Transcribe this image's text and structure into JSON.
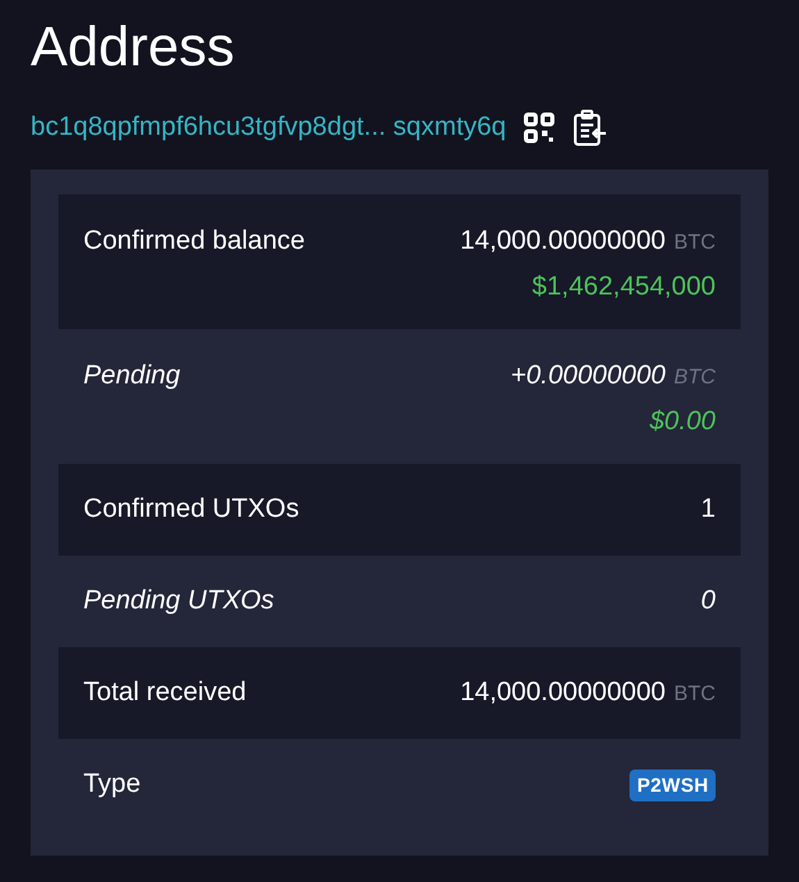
{
  "title": "Address",
  "address": {
    "start": "bc1q8qpfmpf6hcu3tgfvp8dgt...",
    "end": "sqxmty6q"
  },
  "rows": [
    {
      "kind": "amount",
      "label": "Confirmed balance",
      "pending": false,
      "value": "14,000.00000000",
      "unit": "BTC",
      "fiat": "$1,462,454,000"
    },
    {
      "kind": "amount",
      "label": "Pending",
      "pending": true,
      "value": "+0.00000000",
      "unit": "BTC",
      "fiat": "$0.00"
    },
    {
      "kind": "count",
      "label": "Confirmed UTXOs",
      "pending": false,
      "value": "1"
    },
    {
      "kind": "count",
      "label": "Pending UTXOs",
      "pending": true,
      "value": "0"
    },
    {
      "kind": "amount",
      "label": "Total received",
      "pending": false,
      "value": "14,000.00000000",
      "unit": "BTC"
    },
    {
      "kind": "badge",
      "label": "Type",
      "pending": false,
      "value": "P2WSH"
    }
  ]
}
